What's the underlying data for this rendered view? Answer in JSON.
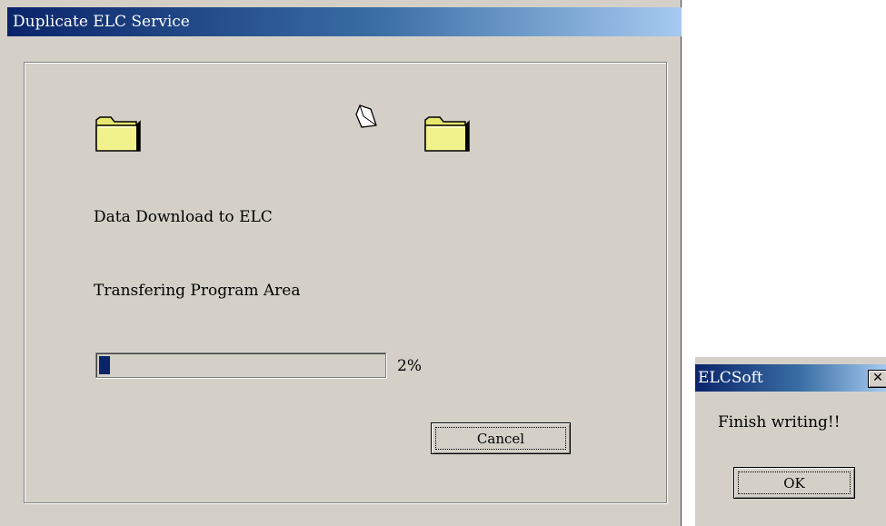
{
  "main_dialog": {
    "title": "Duplicate ELC Service",
    "operation_text": "Data Download to  ELC",
    "status_text": "Transfering  Program Area",
    "progress": {
      "value_percent": 2,
      "label": "2%"
    },
    "cancel_label": "Cancel"
  },
  "message_box": {
    "title": "ELCSoft",
    "close_glyph": "✕",
    "message": "Finish writing!!",
    "ok_label": "OK"
  },
  "colors": {
    "dialog_bg": "#d4d0c8",
    "titlebar_start": "#0a246a",
    "titlebar_end": "#a6caf0",
    "progress_fill": "#0a246a",
    "folder_yellow": "#f2f28c"
  },
  "icons": {
    "source": "folder-icon",
    "transfer": "flying-paper-icon",
    "destination": "folder-icon"
  }
}
